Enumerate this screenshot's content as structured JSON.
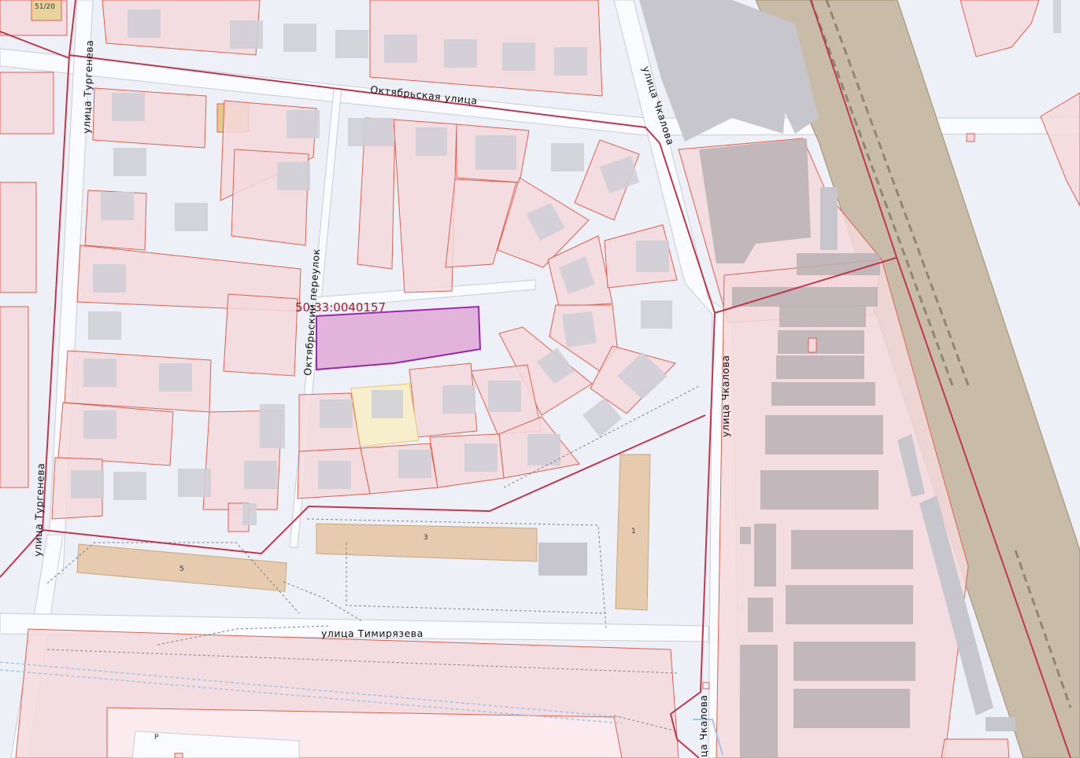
{
  "map": {
    "colors": {
      "background": "#eef0f7",
      "parcel_fill": "#f3d9dc",
      "parcel_stroke": "#e0604e",
      "boundary": "#c0374a",
      "selected_fill": "#e2b4dc",
      "selected_stroke": "#9c27b0",
      "highlight_parcel": "#f7efcc",
      "apartment_block": "#e6cbaf",
      "railway": "#c8bca8"
    },
    "selected_parcel": {
      "cadastral_number": "50:33:0040157"
    },
    "streets": {
      "oktyabrskaya": "Октябрьская  улица",
      "oktyabrsky_pereulok": "Октябрьский переулок",
      "turgeneva_top": "улица  Тургенева",
      "turgeneva_bottom": "улица  Тургенева",
      "chkalova_top": "улица  Чкалова",
      "chkalova_mid": "улица  Чкалова",
      "chkalova_bottom": "улица  Чкалова",
      "timiryazeva": "улица  Тимирязева"
    },
    "house_numbers": {
      "n5": "5",
      "n3": "3",
      "n1": "1",
      "corner": "51/20",
      "p": "P"
    }
  }
}
